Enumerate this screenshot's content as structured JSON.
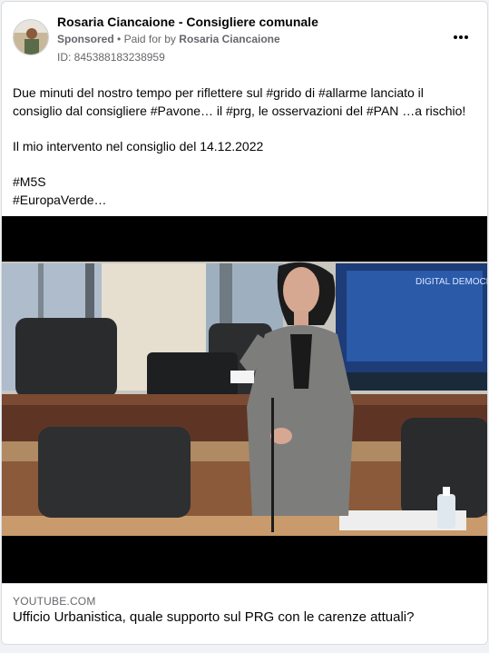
{
  "post": {
    "page_name": "Rosaria Ciancaione - Consigliere comunale",
    "sponsored_label": "Sponsored",
    "separator": "•",
    "paid_for_label": "Paid for by",
    "payer": "Rosaria Ciancaione",
    "ad_id": "ID: 845388183238959",
    "more_icon": "more-horizontal-icon",
    "body": {
      "line1": "Due minuti del nostro tempo per riflettere sul #grido di #allarme lanciato il consiglio dal consigliere #Pavone… il #prg, le osservazioni del #PAN …a rischio!",
      "line2": "Il mio intervento nel consiglio del 14.12.2022",
      "line3": "#M5S",
      "line4": "#EuropaVerde…"
    }
  },
  "media": {
    "watermark": "DIGITAL DEMOCRACY"
  },
  "link_preview": {
    "domain": "YOUTUBE.COM",
    "title": "Ufficio Urbanistica, quale supporto sul PRG con le carenze attuali?"
  }
}
